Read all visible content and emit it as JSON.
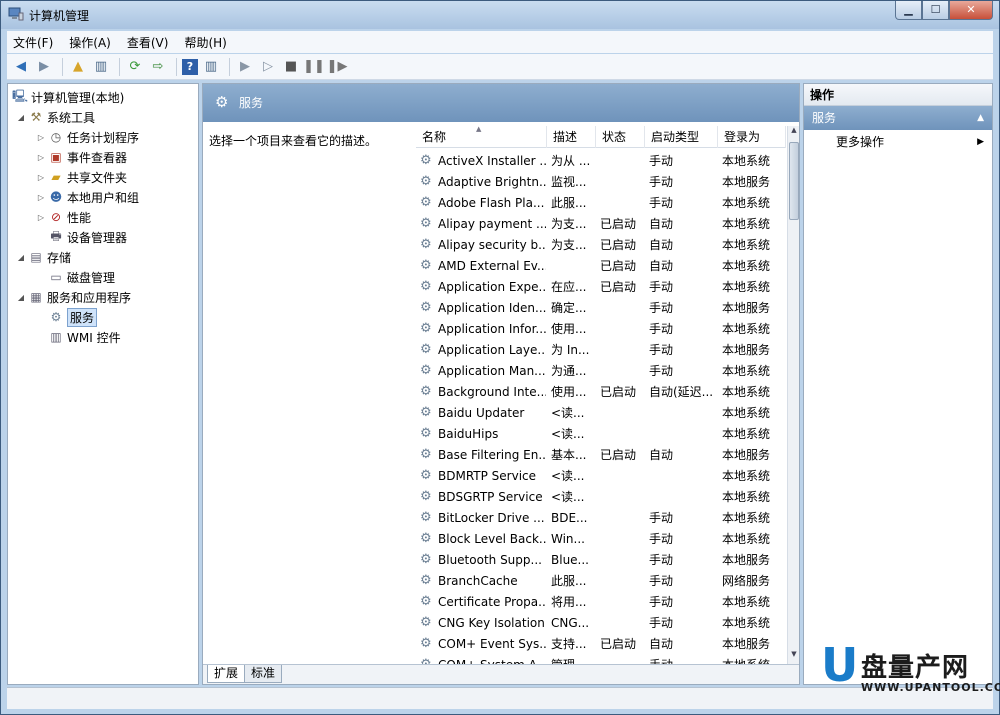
{
  "window": {
    "title": "计算机管理",
    "btn_min": "▁",
    "btn_max": "☐",
    "btn_close": "✕"
  },
  "menu": [
    "文件(F)",
    "操作(A)",
    "查看(V)",
    "帮助(H)"
  ],
  "tree": {
    "root": "计算机管理(本地)",
    "system_tools": "系统工具",
    "task_scheduler": "任务计划程序",
    "event_viewer": "事件查看器",
    "shared_folders": "共享文件夹",
    "local_users": "本地用户和组",
    "performance": "性能",
    "device_manager": "设备管理器",
    "storage": "存储",
    "disk_mgmt": "磁盘管理",
    "services_apps": "服务和应用程序",
    "services": "服务",
    "wmi": "WMI 控件"
  },
  "center": {
    "title": "服务",
    "description": "选择一个项目来查看它的描述。",
    "columns": {
      "name": "名称",
      "desc": "描述",
      "state": "状态",
      "start": "启动类型",
      "logon": "登录为"
    },
    "services": [
      [
        "ActiveX Installer ...",
        "为从 ...",
        "",
        "手动",
        "本地系统"
      ],
      [
        "Adaptive Brightn...",
        "监视...",
        "",
        "手动",
        "本地服务"
      ],
      [
        "Adobe Flash Pla...",
        "此服...",
        "",
        "手动",
        "本地系统"
      ],
      [
        "Alipay payment ...",
        "为支...",
        "已启动",
        "自动",
        "本地系统"
      ],
      [
        "Alipay security b...",
        "为支...",
        "已启动",
        "自动",
        "本地系统"
      ],
      [
        "AMD External Ev...",
        "",
        "已启动",
        "自动",
        "本地系统"
      ],
      [
        "Application Expe...",
        "在应...",
        "已启动",
        "手动",
        "本地系统"
      ],
      [
        "Application Iden...",
        "确定...",
        "",
        "手动",
        "本地服务"
      ],
      [
        "Application Infor...",
        "使用...",
        "",
        "手动",
        "本地系统"
      ],
      [
        "Application Laye...",
        "为 In...",
        "",
        "手动",
        "本地服务"
      ],
      [
        "Application Man...",
        "为通...",
        "",
        "手动",
        "本地系统"
      ],
      [
        "Background Inte...",
        "使用...",
        "已启动",
        "自动(延迟...",
        "本地系统"
      ],
      [
        "Baidu Updater",
        "<读...",
        "",
        "",
        "本地系统"
      ],
      [
        "BaiduHips",
        "<读...",
        "",
        "",
        "本地系统"
      ],
      [
        "Base Filtering En...",
        "基本...",
        "已启动",
        "自动",
        "本地服务"
      ],
      [
        "BDMRTP Service",
        "<读...",
        "",
        "",
        "本地系统"
      ],
      [
        "BDSGRTP Service",
        "<读...",
        "",
        "",
        "本地系统"
      ],
      [
        "BitLocker Drive ...",
        "BDE...",
        "",
        "手动",
        "本地系统"
      ],
      [
        "Block Level Back...",
        "Win...",
        "",
        "手动",
        "本地系统"
      ],
      [
        "Bluetooth Supp...",
        "Blue...",
        "",
        "手动",
        "本地服务"
      ],
      [
        "BranchCache",
        "此服...",
        "",
        "手动",
        "网络服务"
      ],
      [
        "Certificate Propa...",
        "将用...",
        "",
        "手动",
        "本地系统"
      ],
      [
        "CNG Key Isolation",
        "CNG...",
        "",
        "手动",
        "本地系统"
      ],
      [
        "COM+ Event Sys...",
        "支持...",
        "已启动",
        "自动",
        "本地服务"
      ],
      [
        "COM+ System A...",
        "管理...",
        "",
        "手动",
        "本地系统"
      ]
    ],
    "tabs": [
      "扩展",
      "标准"
    ]
  },
  "actions": {
    "header": "操作",
    "group": "服务",
    "more": "更多操作"
  },
  "watermark": {
    "cn": "盘量产网",
    "url": "WWW.UPANTOOL.COM"
  }
}
